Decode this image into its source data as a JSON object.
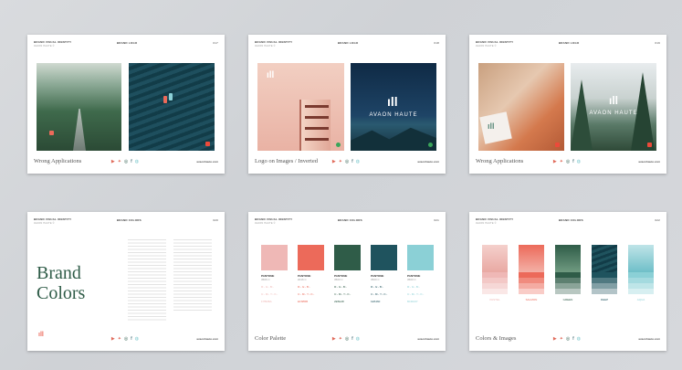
{
  "common": {
    "header_left": "BRAND VISUAL IDENTITY",
    "header_sub": "AVAON HAUTE ©",
    "website": "avaonhaute.com",
    "logo": "AVAON HAUTE"
  },
  "cards": [
    {
      "center": "BRAND LOGO",
      "page": "017",
      "footer": "Wrong Applications"
    },
    {
      "center": "BRAND LOGO",
      "page": "018",
      "footer": "Logo on Images / Inverted"
    },
    {
      "center": "BRAND LOGO",
      "page": "019",
      "footer": "Wrong Applications"
    },
    {
      "center": "BRAND COLORS",
      "page": "020",
      "footer": "",
      "big_title_1": "Brand",
      "big_title_2": "Colors"
    },
    {
      "center": "BRAND COLORS",
      "page": "021",
      "footer": "Color Palette"
    },
    {
      "center": "BRAND COLORS",
      "page": "022",
      "footer": "Colors & Images"
    }
  ],
  "palette": [
    {
      "name": "PANTONE",
      "code": "3506 C",
      "color": "#efb8b6",
      "rgb": "R:- G:- B:-",
      "cmyk": "C:- M:- Y:- K:-",
      "hex": "F7BDBA"
    },
    {
      "name": "PANTONE",
      "code": "2016 C",
      "color": "#ec6a5a",
      "rgb": "R:- G:- B:-",
      "cmyk": "C:- M:- Y:- K:-",
      "hex": "EF6B5B"
    },
    {
      "name": "PANTONE",
      "code": "3500 C",
      "color": "#2f5c48",
      "rgb": "R:- G:- B:-",
      "cmyk": "C:- M:- Y:- K:-",
      "hex": "2E5E48"
    },
    {
      "name": "PANTONE",
      "code": "3500 C",
      "color": "#1f535e",
      "rgb": "R:- G:- B:-",
      "cmyk": "C:- M:- Y:- K:-",
      "hex": "1E5460"
    },
    {
      "name": "PANTONE",
      "code": "3500 C",
      "color": "#8bd0d6",
      "rgb": "R:- G:- B:-",
      "cmyk": "C:- M:- Y:- K:-",
      "hex": "8CD1D7"
    }
  ],
  "icons": [
    "youtube-icon",
    "twitter-icon",
    "instagram-icon",
    "facebook-icon",
    "skype-icon"
  ],
  "icon_glyphs": [
    "▶",
    "✦",
    "◎",
    "f",
    "◍"
  ],
  "strip_labels": [
    "PASTEL",
    "SALMON",
    "GREEN",
    "DEEP",
    "AQUA"
  ]
}
